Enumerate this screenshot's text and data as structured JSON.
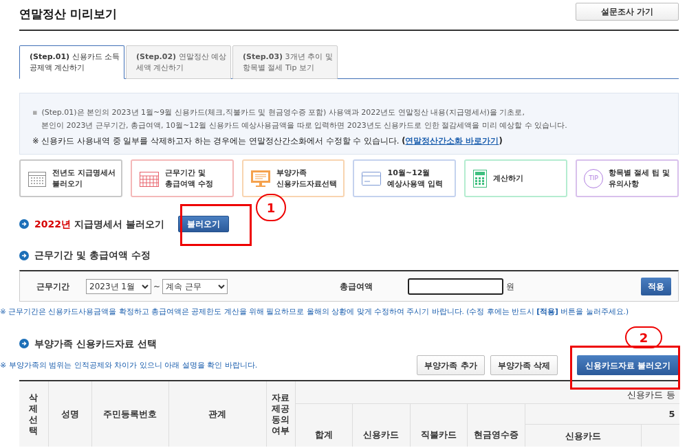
{
  "page_title": "연말정산 미리보기",
  "survey_button": "설문조사 가기",
  "tabs": [
    {
      "step": "(Step.01)",
      "label": "신용카드 소득공제액 계산하기",
      "selected": true
    },
    {
      "step": "(Step.02)",
      "label": "연말정산 예상세액 계산하기",
      "selected": false
    },
    {
      "step": "(Step.03)",
      "label": "3개년 추이 및 항목별 절세 Tip 보기",
      "selected": false
    }
  ],
  "info": {
    "bullet": "▪",
    "link_open": "(",
    "link_close": ")",
    "lines": [
      "(Step.01)은 본인의 2023년 1월~9월 신용카드(체크,직불카드 및 현금영수증 포함) 사용액과 2022년도 연말정산 내용(지급명세서)을 기초로,",
      "본인이 2023년 근무기간, 총급여액, 10월~12월 신용카드 예상사용금액을 따로 입력하면 2023년도 신용카드로 인한 절감세액을 미리 예상할 수 있습니다."
    ],
    "note": "※ 신용카드 사용내역 중 일부를 삭제하고자 하는 경우에는 연말정산간소화에서 수정할 수 있습니다.",
    "link": "연말정산간소화 바로가기"
  },
  "steps": [
    {
      "kind": "ledger",
      "label": "전년도 지급명세서 불러오기",
      "color": "#c8c8c8"
    },
    {
      "kind": "calendar",
      "label": "근무기간 및 총급여액 수정",
      "color": "#f4b8b8"
    },
    {
      "kind": "monitor",
      "label": "부양가족 신용카드자료선택",
      "color": "#f8d4b0"
    },
    {
      "kind": "card",
      "label": "10월~12월 예상사용액 입력",
      "color": "#c4d2ee"
    },
    {
      "kind": "calculator",
      "label": "계산하기",
      "color": "#b4ecd0"
    },
    {
      "kind": "tip",
      "label": "항목별 절세 팁 및 유의사항",
      "color": "#d8c0ec",
      "icon_text": "TIP"
    }
  ],
  "section1": {
    "year": "2022년",
    "title": "지급명세서 불러오기",
    "button": "불러오기"
  },
  "section2": {
    "title": "근무기간 및 총급여액 수정",
    "period_label": "근무기간",
    "start": "2023년 1월",
    "separator": "~",
    "end": "계속 근무",
    "salary_label": "총급여액",
    "unit": "원",
    "apply_button": "적용",
    "note": "※ 근무기간은 신용카드사용금액을 확정하고 총급여액은 공제한도 계산을 위해 필요하므로 올해의 상황에 맞게 수정하여 주시기 바랍니다. (수정 후에는 반드시 **[적용]** 버튼을 눌러주세요.)"
  },
  "section3": {
    "title": "부양가족 신용카드자료 선택",
    "note": "※ 부양가족의 범위는 인적공제와 차이가 있으니 아래 설명을 확인 바랍니다.",
    "buttons": [
      "부양가족 추가",
      "부양가족 삭제"
    ],
    "load_button": "신용카드자료 불러오기",
    "table": {
      "fixed_columns": [
        "삭제선택",
        "성명",
        "주민등록번호",
        "관계",
        "자료제공동의여부"
      ],
      "group_header": "신용카드 등",
      "subgroup_header": "5",
      "columns": [
        "합계",
        "신용카드",
        "직불카드",
        "현금영수증",
        "신용카드"
      ]
    }
  },
  "annotations": [
    {
      "number": "1"
    },
    {
      "number": "2"
    }
  ]
}
